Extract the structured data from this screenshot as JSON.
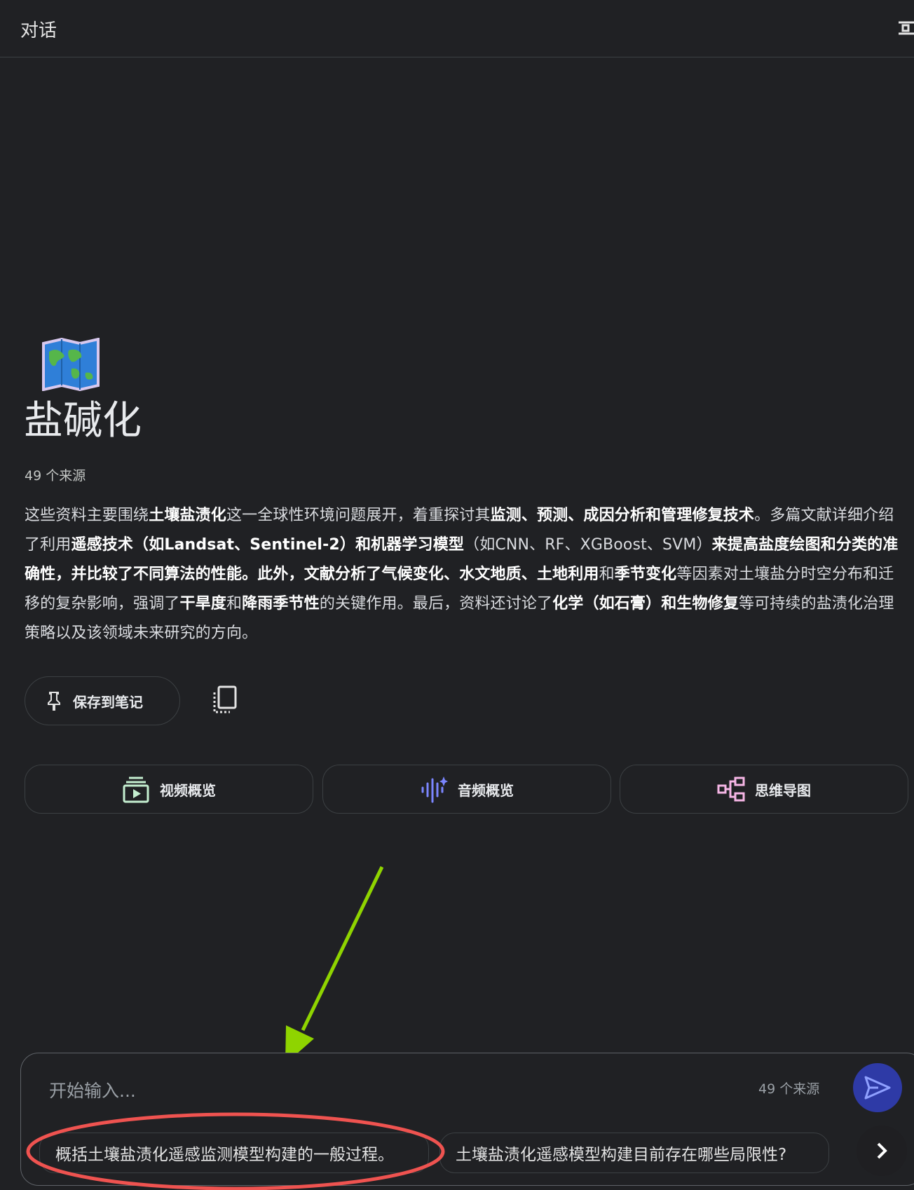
{
  "header": {
    "title": "对话",
    "settings_icon": "tune-icon"
  },
  "notebook": {
    "emoji_icon": "world-map-icon",
    "title": "盐碱化",
    "sources": "49 个来源",
    "summary": [
      {
        "t": "这些资料主要围绕",
        "b": false
      },
      {
        "t": "土壤盐渍化",
        "b": true
      },
      {
        "t": "这一全球性环境问题展开，着重探讨其",
        "b": false
      },
      {
        "t": "监测、预测、成因分析和管理修复技术",
        "b": true
      },
      {
        "t": "。多篇文献详细介绍了利用",
        "b": false
      },
      {
        "t": "遥感技术（如Landsat、Sentinel-2）和机器学习模型",
        "b": true
      },
      {
        "t": "（如CNN、RF、XGBoost、SVM）",
        "b": false
      },
      {
        "t": "来提高盐度绘图和分类的准确性，并比较了不同算法的性能。此外，文献分析了气候变化、水文地质、土地利用",
        "b": true
      },
      {
        "t": "和",
        "b": false
      },
      {
        "t": "季节变化",
        "b": true
      },
      {
        "t": "等因素对土壤盐分时空分布和迁移的复杂影响，强调了",
        "b": false
      },
      {
        "t": "干旱度",
        "b": true
      },
      {
        "t": "和",
        "b": false
      },
      {
        "t": "降雨季节性",
        "b": true
      },
      {
        "t": "的关键作用。最后，资料还讨论了",
        "b": false
      },
      {
        "t": "化学（如石膏）和生物修复",
        "b": true
      },
      {
        "t": "等可持续的盐渍化治理策略以及该领域未来研究的方向。",
        "b": false
      }
    ]
  },
  "actions": {
    "save_label": "保存到笔记",
    "save_icon": "pin-icon",
    "copy_icon": "copy-icon"
  },
  "studio": [
    {
      "label": "视频概览",
      "icon": "video-overview-icon",
      "color": "#c4eed0"
    },
    {
      "label": "音频概览",
      "icon": "audio-overview-icon",
      "color": "#7b86ff"
    },
    {
      "label": "思维导图",
      "icon": "mind-map-icon",
      "color": "#f6b6e6"
    }
  ],
  "composer": {
    "placeholder": "开始输入...",
    "source_count": "49 个来源",
    "send_icon": "send-icon"
  },
  "suggestions": [
    "概括土壤盐渍化遥感监测模型构建的一般过程。",
    "土壤盐渍化遥感模型构建目前存在哪些局限性?"
  ],
  "colors": {
    "annotation_arrow": "#8fd400",
    "annotation_ellipse": "#ef5350",
    "send_bg": "#2e3aa6"
  }
}
